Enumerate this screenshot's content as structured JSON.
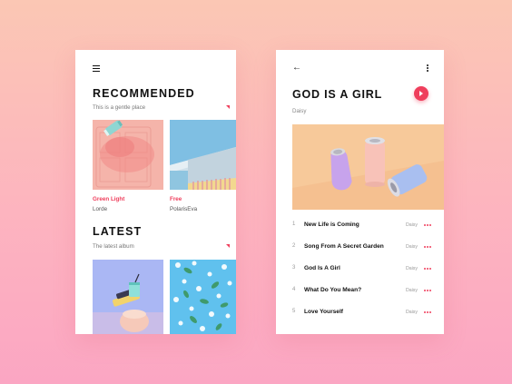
{
  "recommended": {
    "title": "RECOMMENDED",
    "subtitle": "This is a gentle place",
    "items": [
      {
        "title": "Green Light",
        "artist": "Lorde"
      },
      {
        "title": "Free",
        "artist": "PolarisEva"
      }
    ]
  },
  "latest": {
    "title": "LATEST",
    "subtitle": "The latest album"
  },
  "player": {
    "title": "GOD IS A GIRL",
    "artist": "Daisy",
    "tracks": [
      {
        "num": "1",
        "name": "New Life is Coming",
        "artist": "Daisy"
      },
      {
        "num": "2",
        "name": "Song From A Secret Garden",
        "artist": "Daisy"
      },
      {
        "num": "3",
        "name": "God Is A Girl",
        "artist": "Daisy"
      },
      {
        "num": "4",
        "name": "What Do You Mean?",
        "artist": "Daisy"
      },
      {
        "num": "5",
        "name": "Love Yourself",
        "artist": "Daisy"
      }
    ]
  },
  "colors": {
    "accent": "#ef3e5c",
    "background_top": "#fbc7b4",
    "background_bottom": "#fba6c3"
  },
  "icons": [
    "menu-icon",
    "back-arrow-icon",
    "more-vert-icon",
    "play-icon",
    "more-horiz-icon"
  ]
}
